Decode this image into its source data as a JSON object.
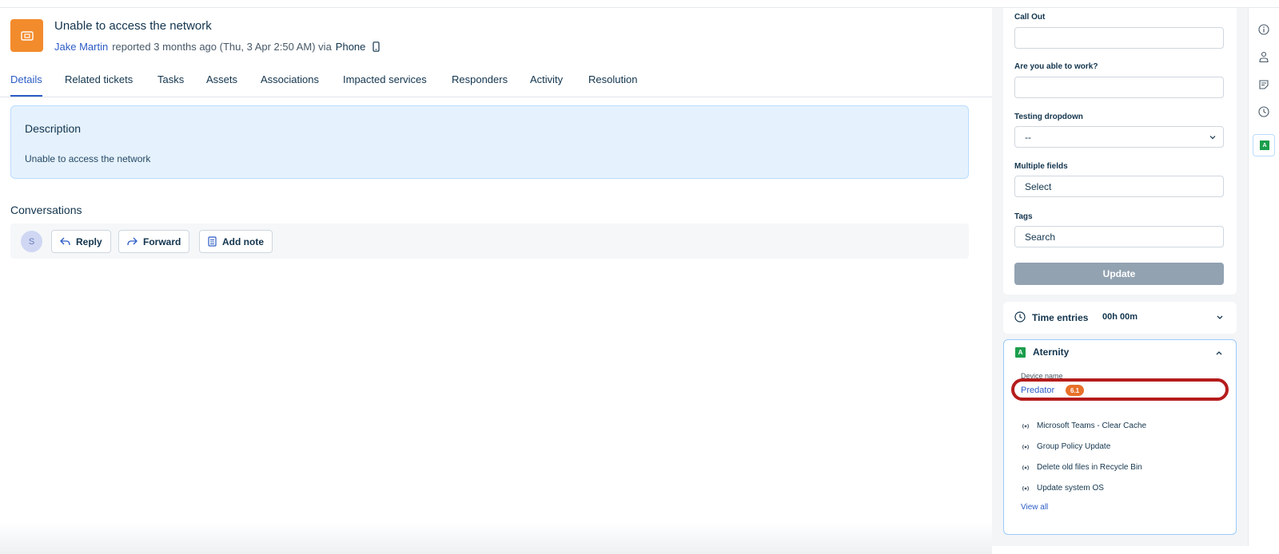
{
  "ticket": {
    "title": "Unable to access the network",
    "author": "Jake Martin",
    "reported_text": "reported 3 months ago (Thu, 3 Apr 2:50 AM) via",
    "channel": "Phone"
  },
  "tabs": [
    {
      "label": "Details",
      "active": true
    },
    {
      "label": "Related tickets"
    },
    {
      "label": "Tasks"
    },
    {
      "label": "Assets"
    },
    {
      "label": "Associations"
    },
    {
      "label": "Impacted services"
    },
    {
      "label": "Responders"
    },
    {
      "label": "Activity"
    },
    {
      "label": "Resolution"
    }
  ],
  "description": {
    "heading": "Description",
    "text": "Unable to access the network"
  },
  "conversations": {
    "heading": "Conversations",
    "avatar_initial": "S",
    "reply_label": "Reply",
    "forward_label": "Forward",
    "add_note_label": "Add note"
  },
  "properties": {
    "call_out_label": "Call Out",
    "call_out_value": "",
    "able_to_work_label": "Are you able to work?",
    "able_to_work_value": "",
    "testing_dropdown_label": "Testing dropdown",
    "testing_dropdown_value": "--",
    "multiple_fields_label": "Multiple fields",
    "multiple_fields_value": "Select",
    "tags_label": "Tags",
    "tags_placeholder": "Search",
    "update_label": "Update"
  },
  "time_entries": {
    "label": "Time entries",
    "value": "00h 00m"
  },
  "aternity": {
    "logo_letter": "A",
    "title": "Aternity",
    "device_label": "Device name",
    "device_name": "Predator",
    "device_score": "6.1",
    "actions": [
      "Microsoft Teams - Clear Cache",
      "Group Policy Update",
      "Delete old files in Recycle Bin",
      "Update system OS"
    ],
    "view_all": "View all"
  },
  "rail": {
    "active_letter": "A"
  },
  "colors": {
    "accent": "#2c5cc5",
    "ticket_icon": "#f28b2c",
    "aternity_green": "#1b9e4c",
    "score_orange": "#e8702a",
    "highlight_red": "#b51c1c"
  }
}
